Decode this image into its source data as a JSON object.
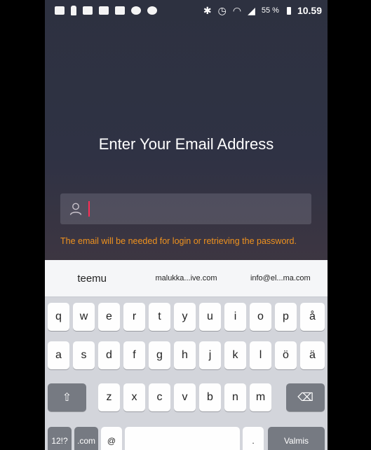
{
  "status_bar": {
    "left_icons": [
      "message-icon",
      "person-icon",
      "camera-icon",
      "camera-icon",
      "mail-icon",
      "skype-icon",
      "dot-icon"
    ],
    "right_icons": [
      "bluetooth-icon",
      "alarm-icon",
      "wifi-icon",
      "signal-icon"
    ],
    "battery": "55 %",
    "time": "10.59"
  },
  "screen": {
    "title": "Enter Your Email Address",
    "email_value": "",
    "hint": "The email will be needed for login or retrieving the password."
  },
  "keyboard": {
    "suggestions": [
      "teemu",
      "malukka...ive.com",
      "info@el...ma.com"
    ],
    "row1": [
      "q",
      "w",
      "e",
      "r",
      "t",
      "y",
      "u",
      "i",
      "o",
      "p",
      "å"
    ],
    "row2": [
      "a",
      "s",
      "d",
      "f",
      "g",
      "h",
      "j",
      "k",
      "l",
      "ö",
      "ä"
    ],
    "row3": [
      "z",
      "x",
      "c",
      "v",
      "b",
      "n",
      "m"
    ],
    "shift": "⇧",
    "numbers": "12!?",
    "dotcom": ".com",
    "at": "@",
    "dot": ".",
    "done": "Valmis",
    "backspace": "⌫"
  },
  "colors": {
    "hint": "#f0921e",
    "cursor": "#ff2d55",
    "keyboard_bg": "#d3d5db"
  }
}
